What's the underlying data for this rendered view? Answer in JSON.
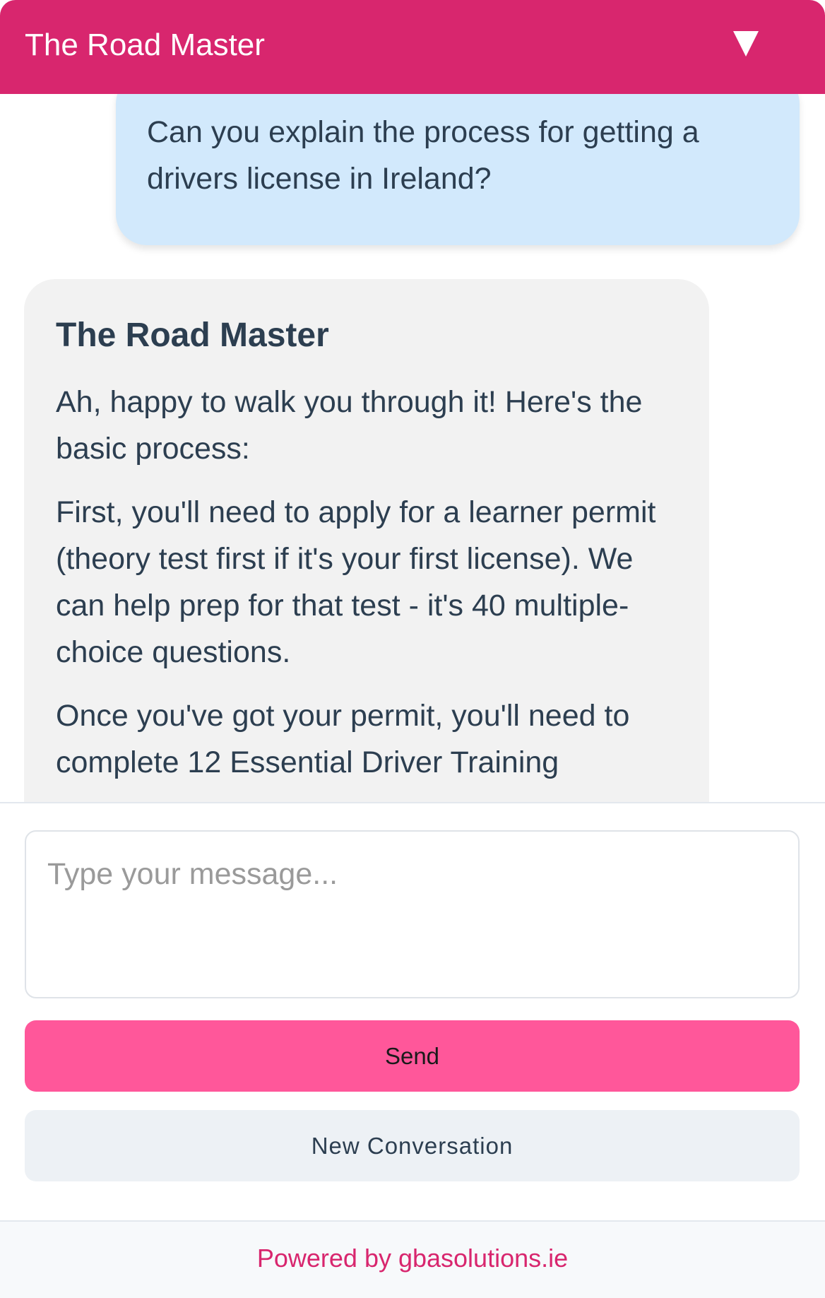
{
  "header": {
    "title": "The Road Master",
    "toggle_icon": "triangle-down-icon",
    "color": "#d8266e"
  },
  "messages": {
    "user": {
      "text": "Can you explain the process for getting a drivers license in Ireland?"
    },
    "bot": {
      "name": "The Road Master",
      "paragraphs": [
        "Ah, happy to walk you through it! Here's the basic process:",
        "First, you'll need to apply for a learner permit (theory test first if it's your first license). We can help prep for that test - it's 40 multiple-choice questions.",
        "Once you've got your permit, you'll need to complete 12 Essential Driver Training"
      ]
    }
  },
  "composer": {
    "placeholder": "Type your message...",
    "value": "",
    "send_label": "Send",
    "send_color": "#ff579a",
    "new_conversation_label": "New Conversation"
  },
  "footer": {
    "powered_by": "Powered by gbasolutions.ie"
  }
}
